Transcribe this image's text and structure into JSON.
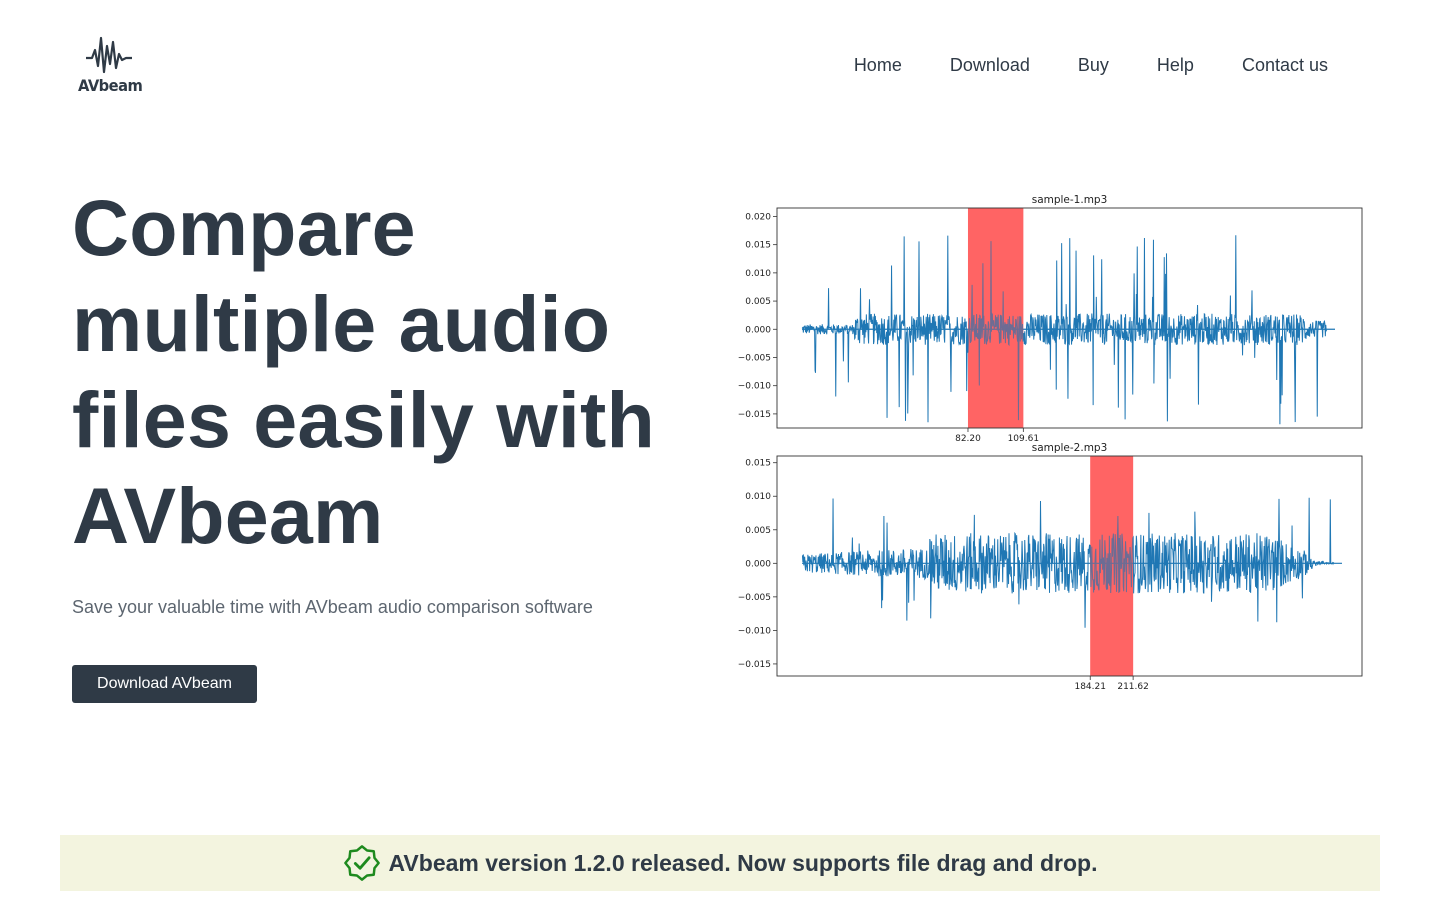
{
  "brand": {
    "name": "AVbeam",
    "icon": "waveform-icon"
  },
  "nav": {
    "items": [
      "Home",
      "Download",
      "Buy",
      "Help",
      "Contact us"
    ]
  },
  "hero": {
    "title": "Compare multiple audio files easily with AVbeam",
    "subtitle": "Save your valuable time with AVbeam audio comparison software",
    "cta_label": "Download AVbeam"
  },
  "announcement": {
    "icon": "verified-badge-icon",
    "text": "AVbeam version 1.2.0 released. Now supports file drag and drop.",
    "icon_color": "#1e8a1e"
  },
  "colors": {
    "text": "#2f3a46",
    "button": "#2f3a46",
    "banner_bg": "#f3f4df",
    "waveform": "#1f77b4",
    "highlight": "#ff5a5a"
  },
  "chart_data": [
    {
      "type": "line",
      "title": "sample-1.mp3",
      "ylim": [
        -0.0175,
        0.0215
      ],
      "yticks": [
        "0.020",
        "0.015",
        "0.010",
        "0.005",
        "0.000",
        "−0.005",
        "−0.010",
        "−0.015"
      ],
      "ytick_values": [
        0.02,
        0.015,
        0.01,
        0.005,
        0.0,
        -0.005,
        -0.01,
        -0.015
      ],
      "highlight": {
        "start_label": "82.20",
        "end_label": "109.61",
        "start": 82.2,
        "end": 109.61
      },
      "x_range": [
        0,
        260
      ]
    },
    {
      "type": "line",
      "title": "sample-2.mp3",
      "ylim": [
        -0.0168,
        0.016
      ],
      "yticks": [
        "0.015",
        "0.010",
        "0.005",
        "0.000",
        "−0.005",
        "−0.010",
        "−0.015"
      ],
      "ytick_values": [
        0.015,
        0.01,
        0.005,
        0.0,
        -0.005,
        -0.01,
        -0.015
      ],
      "highlight": {
        "start_label": "184.21",
        "end_label": "211.62",
        "start": 184.21,
        "end": 211.62
      },
      "x_range": [
        0,
        340
      ]
    }
  ]
}
